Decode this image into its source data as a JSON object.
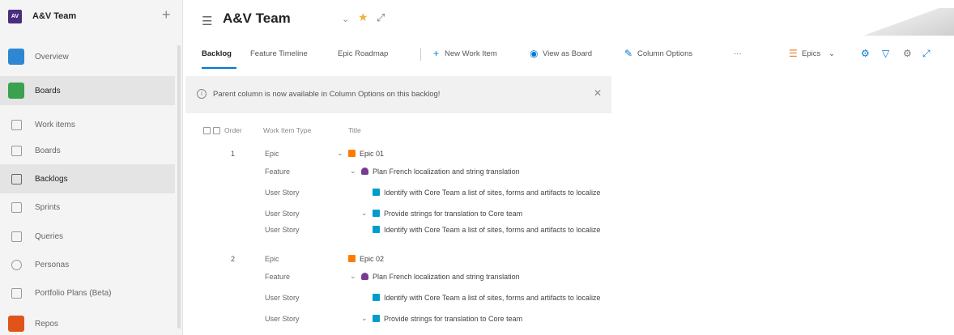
{
  "project": {
    "avatar": "AV",
    "name": "A&V Team",
    "add_icon": "+"
  },
  "sidebar": {
    "items": [
      {
        "label": "Overview",
        "icon": "overview-icon",
        "color": "#2f86d1"
      },
      {
        "label": "Boards",
        "icon": "boards-hub-icon",
        "color": "#3aa14f"
      },
      {
        "label": "Work items",
        "icon": "work-items-icon"
      },
      {
        "label": "Boards",
        "icon": "boards-icon"
      },
      {
        "label": "Backlogs",
        "icon": "backlogs-icon"
      },
      {
        "label": "Sprints",
        "icon": "sprints-icon"
      },
      {
        "label": "Queries",
        "icon": "queries-icon"
      },
      {
        "label": "Personas",
        "icon": "personas-icon"
      },
      {
        "label": "Portfolio Plans (Beta)",
        "icon": "portfolio-plans-icon"
      },
      {
        "label": "Repos",
        "icon": "repos-icon",
        "color": "#e0541a"
      }
    ]
  },
  "header": {
    "title": "A&V Team",
    "icon": "backlog-icon",
    "chevron": "⌄",
    "star": "★",
    "link": "⤢"
  },
  "tabs": [
    {
      "label": "Backlog",
      "active": true
    },
    {
      "label": "Feature Timeline",
      "active": false
    },
    {
      "label": "Epic Roadmap",
      "active": false
    }
  ],
  "toolbar": {
    "new_work_item": "New Work Item",
    "view_as_board": "View as Board",
    "column_options": "Column Options",
    "more": "···",
    "level": "Epics",
    "level_chevron": "⌄"
  },
  "banner": {
    "text": "Parent column is now available in Column Options on this backlog!",
    "info_icon": "i",
    "close": "✕"
  },
  "columns": {
    "order": "Order",
    "type": "Work Item Type",
    "title": "Title"
  },
  "rows": [
    {
      "order": "1",
      "type": "Epic",
      "title": "Epic 01",
      "level": 0,
      "kind": "epic",
      "expander": "⌄"
    },
    {
      "order": "",
      "type": "Feature",
      "title": "Plan French localization and string translation",
      "level": 1,
      "kind": "feature",
      "expander": "⌄"
    },
    {
      "order": "",
      "type": "User Story",
      "title": "Identify with Core Team a list of sites, forms and artifacts to localize",
      "level": 2,
      "kind": "story",
      "expander": ""
    },
    {
      "order": "",
      "type": "User Story",
      "title": "Provide strings for translation to Core team",
      "level": 2,
      "kind": "story",
      "expander": "⌄"
    },
    {
      "order": "",
      "type": "User Story",
      "title": "Identify with Core Team a list of sites, forms and artifacts to localize",
      "level": 2,
      "kind": "story",
      "expander": ""
    },
    {
      "order": "2",
      "type": "Epic",
      "title": "Epic 02",
      "level": 0,
      "kind": "epic",
      "expander": ""
    },
    {
      "order": "",
      "type": "Feature",
      "title": "Plan French localization and string translation",
      "level": 1,
      "kind": "feature",
      "expander": "⌄"
    },
    {
      "order": "",
      "type": "User Story",
      "title": "Identify with Core Team a list of sites, forms and artifacts to localize",
      "level": 2,
      "kind": "story",
      "expander": ""
    },
    {
      "order": "",
      "type": "User Story",
      "title": "Provide strings for translation to Core team",
      "level": 2,
      "kind": "story",
      "expander": "⌄"
    }
  ],
  "colors": {
    "accent": "#0078d4",
    "epic": "#ff7b00",
    "feature": "#773b93",
    "story": "#009ccc"
  }
}
